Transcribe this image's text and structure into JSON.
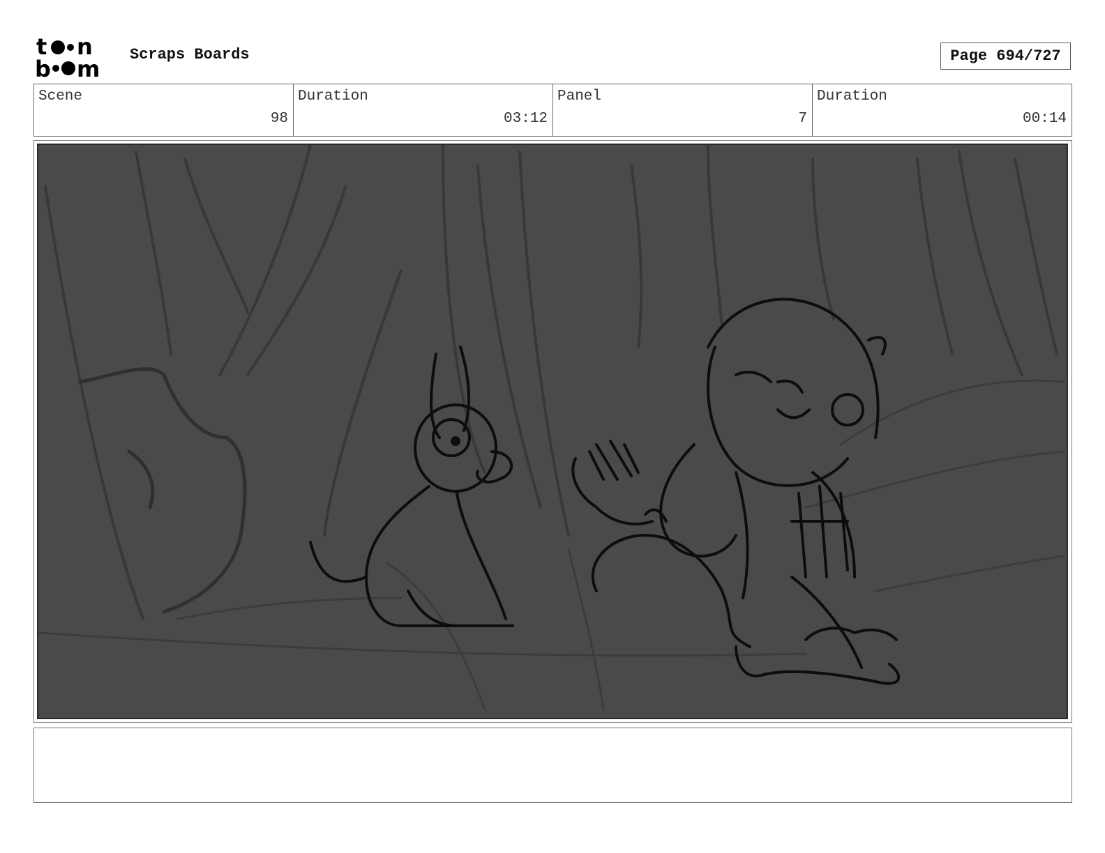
{
  "header": {
    "app_title": "Scraps Boards",
    "page_label": "Page 694/727",
    "logo_text": "toonboom"
  },
  "info": {
    "scene_label": "Scene",
    "scene_value": "98",
    "scene_duration_label": "Duration",
    "scene_duration_value": "03:12",
    "panel_label": "Panel",
    "panel_value": "7",
    "panel_duration_label": "Duration",
    "panel_duration_value": "00:14"
  },
  "notes": {
    "text": ""
  }
}
